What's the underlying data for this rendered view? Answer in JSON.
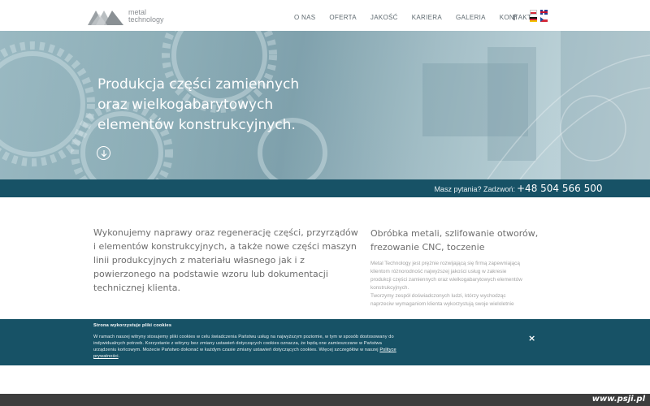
{
  "header": {
    "logo_line1": "metal",
    "logo_line2": "technology",
    "nav": [
      "O NAS",
      "OFERTA",
      "JAKOŚĆ",
      "KARIERA",
      "GALERIA",
      "KONTAKT"
    ],
    "facebook_icon": "facebook-icon",
    "languages": [
      "pl",
      "en",
      "de",
      "cz"
    ]
  },
  "hero": {
    "title_lines": [
      "Produkcja części zamiennych",
      "oraz wielkogabarytowych",
      "elementów konstrukcyjnych."
    ],
    "scroll_icon": "arrow-down-circle-icon"
  },
  "phone_bar": {
    "ask": "Masz pytania? Zadzwoń:",
    "number": "+48 504 566 500"
  },
  "intro": {
    "left_lines": [
      "Wykonujemy naprawy oraz regenerację części, przyrządów",
      "i  elementów konstrukcyjnych, a także nowe części maszyn",
      "linii produkcyjnych z materiału własnego jak i z",
      "powierzonego na podstawie wzoru lub dokumentacji",
      "technicznej klienta."
    ],
    "right_title_lines": [
      "Obróbka metali, szlifowanie otworów,",
      "frezowanie CNC, toczenie"
    ],
    "right_body_lines": [
      "Metal Technology jest prężnie rozwijającą się firmą zapewniającą",
      "klientom różnorodność najwyższej jakości usług w zakresie",
      "produkcji części zamiennych oraz wielkogabarytowych elementów",
      "konstrukcyjnych.",
      "Tworzymy zespół doświadczonych ludzi, którzy wychodząc",
      "naprzeciw wymaganiom klienta wykorzystują swoje wieloletnie"
    ]
  },
  "cookie": {
    "title": "Strona wykorzystuje pliki cookies",
    "lines": [
      "W ramach naszej witryny stosujemy pliki cookies w celu świadczenia Państwu usług na najwyższym poziomie, w tym w sposób dostosowany do",
      "indywidualnych potrzeb. Korzystanie z witryny bez zmiany ustawień dotyczących cookies oznacza, że będą one zamieszczane w Państwa",
      "urządzeniu końcowym. Możecie Państwo dokonać w każdym czasie zmiany ustawień dotyczących cookies. Więcej szczegółów w naszej"
    ],
    "link_part1": "Polityce",
    "link_part2": "prywatności",
    "link_suffix": ".",
    "close": "×"
  },
  "footer": {
    "brand": "www.psji.pl"
  },
  "colors": {
    "accent_dark": "#175266",
    "hero_tint": "#7fa3ae",
    "footer": "#3d3d3d"
  }
}
